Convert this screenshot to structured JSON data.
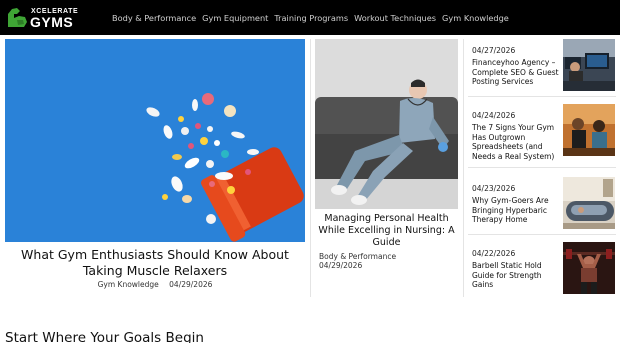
{
  "brand": {
    "name_small": "XCELERATE",
    "name_big": "GYMS",
    "logo_icon": "muscle-arm-icon",
    "accent": "#3fa535"
  },
  "nav": {
    "items": [
      {
        "label": "Body & Performance"
      },
      {
        "label": "Gym Equipment"
      },
      {
        "label": "Training Programs"
      },
      {
        "label": "Workout Techniques"
      },
      {
        "label": "Gym Knowledge"
      }
    ]
  },
  "featured": {
    "title": "What Gym Enthusiasts Should Know About Taking Muscle Relaxers",
    "category": "Gym Knowledge",
    "date": "04/29/2026",
    "image": "pills-bottle-image",
    "bg_color": "#2a82d8"
  },
  "middle": {
    "title": "Managing Personal Health While Excelling in Nursing: A Guide",
    "category": "Body & Performance",
    "date": "04/29/2026",
    "image": "tired-nurse-image"
  },
  "sidebar": {
    "items": [
      {
        "date": "04/27/2026",
        "title": "Financeyhoo Agency – Complete SEO & Guest Posting Services",
        "image": "office-monitors-thumb"
      },
      {
        "date": "04/24/2026",
        "title": "The 7 Signs Your Gym Has Outgrown Spreadsheets (and Needs a Real System)",
        "image": "gym-class-thumb"
      },
      {
        "date": "04/23/2026",
        "title": "Why Gym-Goers Are Bringing Hyperbaric Therapy Home",
        "image": "hyperbaric-chamber-thumb"
      },
      {
        "date": "04/22/2026",
        "title": "Barbell Static Hold Guide for Strength Gains",
        "image": "barbell-lifter-thumb"
      }
    ]
  },
  "section": {
    "heading": "Start Where Your Goals Begin"
  }
}
